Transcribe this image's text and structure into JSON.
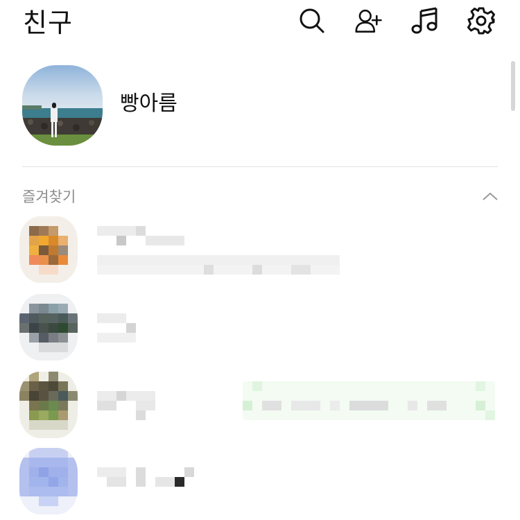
{
  "header": {
    "title": "친구",
    "icons": [
      "search-icon",
      "add-friend-icon",
      "music-icon",
      "settings-icon"
    ]
  },
  "profile": {
    "name": "빵아름"
  },
  "favorites": {
    "title": "즐겨찾기"
  },
  "colors": {
    "text": "#111111",
    "section_title": "#8d8d8d",
    "divider": "#e3e3e3",
    "music_banner": "#eafaea"
  }
}
